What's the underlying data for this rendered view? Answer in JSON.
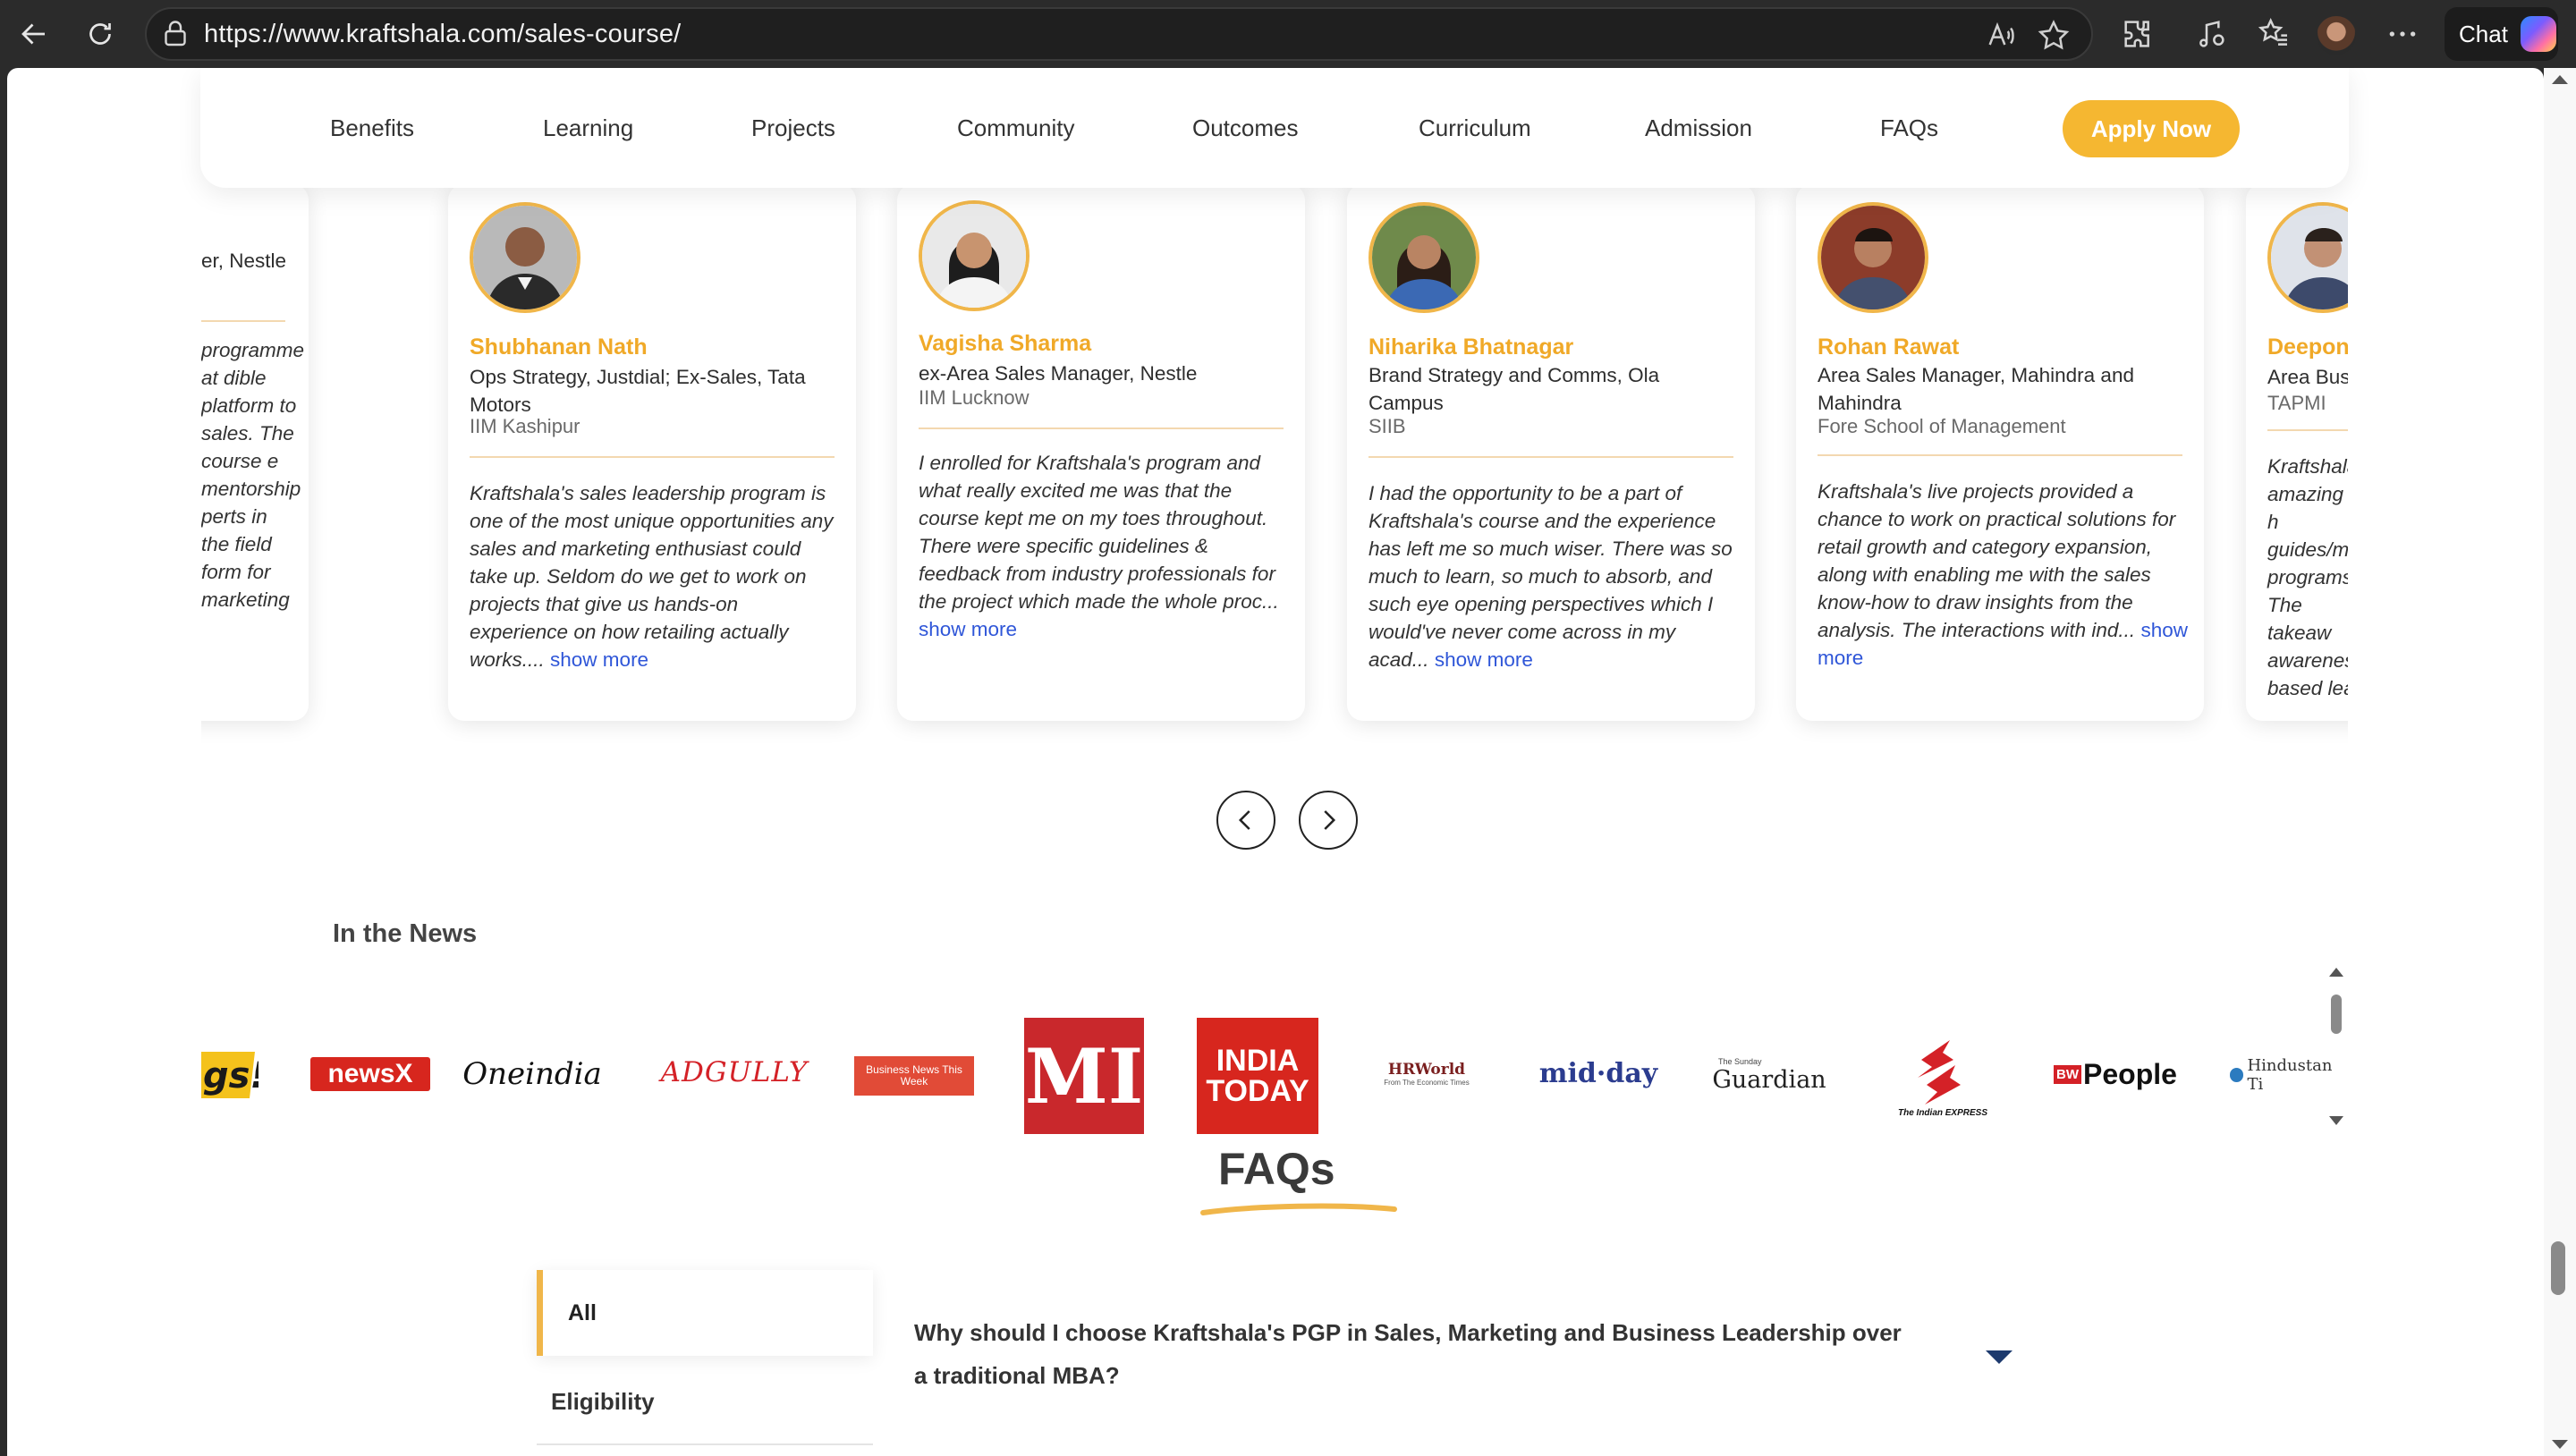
{
  "browser": {
    "url": "https://www.kraftshala.com/sales-course/",
    "chat_label": "Chat"
  },
  "nav": {
    "items": [
      "Benefits",
      "Learning",
      "Projects",
      "Community",
      "Outcomes",
      "Curriculum",
      "Admission",
      "FAQs"
    ],
    "apply_label": "Apply Now"
  },
  "testimonials": [
    {
      "name": "",
      "role": "er, Nestle",
      "school": "",
      "quote": "programme at dible platform to sales. The course e mentorship perts in the field form for marketing",
      "more": ""
    },
    {
      "name": "Shubhanan Nath",
      "role": "Ops Strategy, Justdial; Ex-Sales, Tata Motors",
      "school": "IIM Kashipur",
      "quote": "Kraftshala's sales leadership program is one of the most unique opportunities any sales and marketing enthusiast could take up. Seldom do we get to work on projects that give us hands-on experience on how retailing actually works....",
      "more": "show more"
    },
    {
      "name": "Vagisha Sharma",
      "role": "ex-Area Sales Manager, Nestle",
      "school": "IIM Lucknow",
      "quote": "I enrolled for Kraftshala's program and what really excited me was that the course kept me on my toes throughout. There were specific guidelines & feedback from industry professionals for the project which made the whole proc...",
      "more": "show more"
    },
    {
      "name": "Niharika Bhatnagar",
      "role": "Brand Strategy and Comms, Ola Campus",
      "school": "SIIB",
      "quote": "I had the opportunity to be a part of Kraftshala's course and the experience has left me so much wiser. There was so much to learn, so much to absorb, and such eye opening perspectives which I would've never come across in my acad...",
      "more": "show more"
    },
    {
      "name": "Rohan Rawat",
      "role": "Area Sales Manager, Mahindra and Mahindra",
      "school": "Fore School of Management",
      "quote": "Kraftshala's live projects provided a chance to work on practical solutions for retail growth and category expansion, along with enabling me with the sales know-how to draw insights from the analysis. The interactions with ind...",
      "more": "show more"
    },
    {
      "name": "Deepon",
      "role": "Area Busir",
      "school": "TAPMI",
      "quote": "Kraftshala amazing h guides/m programs The takeaw awarenes based lea",
      "more": ""
    }
  ],
  "news": {
    "title": "In the News",
    "logos": [
      {
        "name": "gs!",
        "color": "#1a1a1a"
      },
      {
        "name": "newsX",
        "color": "#d7261e"
      },
      {
        "name": "Oneindia",
        "color": "#111111"
      },
      {
        "name": "ADGULLY",
        "color": "#d42127"
      },
      {
        "name": "Business News This Week",
        "color": "#e14b37"
      },
      {
        "name": "MI",
        "color": "#c9282c"
      },
      {
        "name": "INDIA TODAY",
        "color": "#d7261e"
      },
      {
        "name": "HRWorld",
        "color": "#7a1f1f"
      },
      {
        "name": "mid-day",
        "color": "#2b3c8f"
      },
      {
        "name": "Guardian",
        "color": "#222222"
      },
      {
        "name": "The Indian EXPRESS",
        "color": "#d42127"
      },
      {
        "name": "People",
        "color": "#111111"
      },
      {
        "name": "Hindustan Ti",
        "color": "#333333"
      }
    ],
    "logo_text": {
      "newsx": "newsX",
      "oneindia": "Oneindia",
      "adgully": "ADGULLY",
      "bnw": "Business News This Week",
      "mi": "MI",
      "indiatoday_1": "INDIA",
      "indiatoday_2": "TODAY",
      "hrworld": "HRWorld",
      "hrworld_sub": "From The Economic Times",
      "midday": "mid·day",
      "guardian_small": "The Sunday",
      "guardian": "Guardian",
      "indianexpress": "The Indian EXPRESS",
      "bw": "BW",
      "people": "People",
      "ht": "Hindustan Ti"
    }
  },
  "faqs": {
    "title": "FAQs",
    "tabs": [
      "All",
      "Eligibility"
    ],
    "question": "Why should I choose Kraftshala's PGP in Sales, Marketing and Business Leadership over a traditional MBA?"
  },
  "colors": {
    "accent": "#f5b731",
    "name": "#f0a928",
    "link": "#2f56d8"
  }
}
